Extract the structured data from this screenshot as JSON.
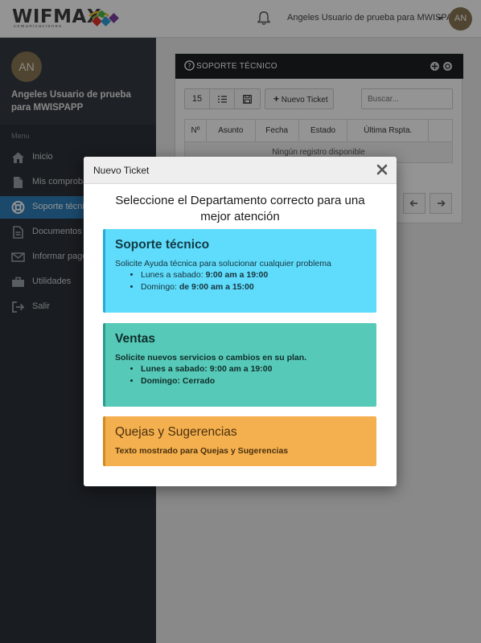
{
  "app": {
    "logo_text": "WIFMAX",
    "logo_sub": "comunicaciones",
    "user_name": "Angeles Usuario de prueba para MWISPAPP",
    "avatar_initials": "AN"
  },
  "sidebar": {
    "avatar_initials": "AN",
    "user_name": "Angeles Usuario de prueba para MWISPAPP",
    "menu_label": "Menu",
    "items": [
      {
        "label": "Inicio",
        "icon": "home-icon"
      },
      {
        "label": "Mis comprobantes",
        "icon": "file-icon"
      },
      {
        "label": "Soporte técnico",
        "icon": "lifebuoy-icon",
        "active": true
      },
      {
        "label": "Documentos",
        "icon": "document-icon"
      },
      {
        "label": "Informar pagos",
        "icon": "envelope-icon"
      },
      {
        "label": "Utilidades",
        "icon": "briefcase-icon"
      },
      {
        "label": "Salir",
        "icon": "sign-out-icon"
      }
    ]
  },
  "panel": {
    "title": "SOPORTE TÉCNICO",
    "page_size": "15",
    "new_ticket_label": "Nuevo Ticket",
    "search_placeholder": "Buscar...",
    "columns": [
      "Nº",
      "Asunto",
      "Fecha",
      "Estado",
      "Última Rspta.",
      ""
    ],
    "empty_message": "Ningún registro disponible"
  },
  "modal": {
    "title": "Nuevo Ticket",
    "heading": "Seleccione el Departamento correcto para una mejor atención",
    "departments": [
      {
        "name": "Soporte técnico",
        "description": "Solicite Ayuda técnica para solucionar cualquier problema",
        "hours": [
          {
            "label": "Lunes a sabado:",
            "value": "9:00 am a 19:00"
          },
          {
            "label": "Domingo:",
            "value": "de 9:00 am a 15:00"
          }
        ],
        "color": "#5fdcfb"
      },
      {
        "name": "Ventas",
        "description": "Solicite nuevos servicios o cambios en su plan.",
        "hours": [
          {
            "label": "Lunes a sabado:",
            "value": "9:00 am a 19:00"
          },
          {
            "label": "Domingo:",
            "value": "Cerrado"
          }
        ],
        "color": "#57c9b8"
      },
      {
        "name": "Quejas y Sugerencias",
        "description": "Texto mostrado para Quejas y Sugerencias",
        "color": "#f4b04e"
      }
    ]
  }
}
